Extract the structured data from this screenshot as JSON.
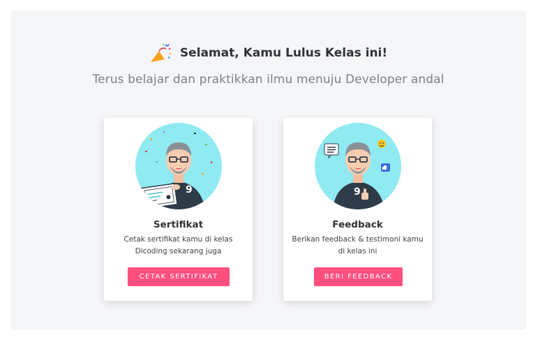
{
  "header": {
    "title": "Selamat, Kamu Lulus Kelas ini!",
    "subtitle": "Terus belajar dan praktikkan ilmu menuju Developer andal"
  },
  "cards": [
    {
      "title": "Sertifikat",
      "description": "Cetak sertifikat kamu di kelas Dicoding sekarang juga",
      "button_label": "CETAK SERTIFIKAT"
    },
    {
      "title": "Feedback",
      "description": "Berikan feedback & testimoni kamu di kelas ini",
      "button_label": "BERI FEEDBACK"
    }
  ],
  "colors": {
    "accent": "#ff4f7f",
    "panel_background": "#f5f6f8",
    "avatar_background": "#8feaf2",
    "shirt": "#2e3b48"
  },
  "icons": {
    "celebration": "party-popper-icon",
    "certificate": "certificate-illustration",
    "feedback": "feedback-illustration"
  }
}
